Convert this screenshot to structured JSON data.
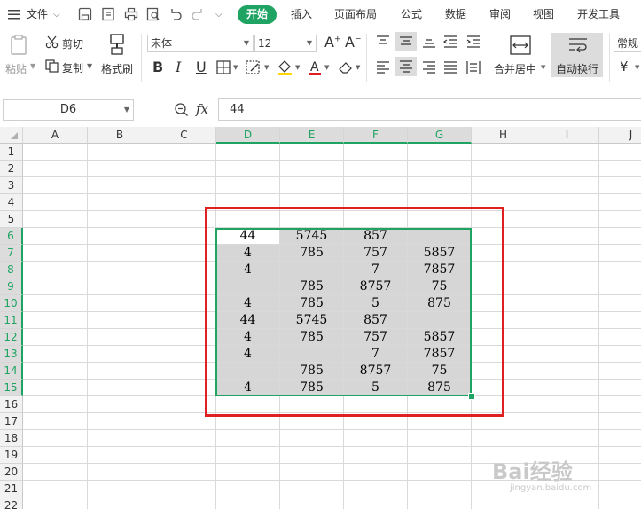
{
  "menu": {
    "file": "文件",
    "tabs": [
      "开始",
      "插入",
      "页面布局",
      "公式",
      "数据",
      "审阅",
      "视图",
      "开发工具"
    ]
  },
  "ribbon": {
    "paste": "粘贴",
    "cut": "剪切",
    "copy": "复制",
    "format_painter": "格式刷",
    "font_name": "宋体",
    "font_size": "12",
    "merge_center": "合并居中",
    "auto_wrap": "自动换行",
    "number_format": "常规",
    "currency_symbol": "¥"
  },
  "formula_bar": {
    "name_box": "D6",
    "fx": "fx",
    "value": "44"
  },
  "columns": [
    "A",
    "B",
    "C",
    "D",
    "E",
    "F",
    "G",
    "H",
    "I",
    "J"
  ],
  "rows": [
    "1",
    "2",
    "3",
    "4",
    "5",
    "6",
    "7",
    "8",
    "9",
    "10",
    "11",
    "12",
    "13",
    "14",
    "15",
    "16",
    "17",
    "18",
    "19",
    "20",
    "21",
    "22"
  ],
  "sheet": {
    "r6": [
      "44",
      "5745",
      "857",
      ""
    ],
    "r7": [
      "4",
      "785",
      "757",
      "5857"
    ],
    "r8": [
      "4",
      "",
      "7",
      "7857"
    ],
    "r9": [
      "",
      "785",
      "8757",
      "75"
    ],
    "r10": [
      "4",
      "785",
      "5",
      "875"
    ],
    "r11": [
      "44",
      "5745",
      "857",
      ""
    ],
    "r12": [
      "4",
      "785",
      "757",
      "5857"
    ],
    "r13": [
      "4",
      "",
      "7",
      "7857"
    ],
    "r14": [
      "",
      "785",
      "8757",
      "75"
    ],
    "r15": [
      "4",
      "785",
      "5",
      "875"
    ]
  },
  "watermark": {
    "brand": "Bai经验",
    "url": "jingyan.baidu.com"
  },
  "colors": {
    "accent": "#1ea362",
    "highlight_box": "#e02020",
    "selected_fill": "#d6d6d6"
  }
}
